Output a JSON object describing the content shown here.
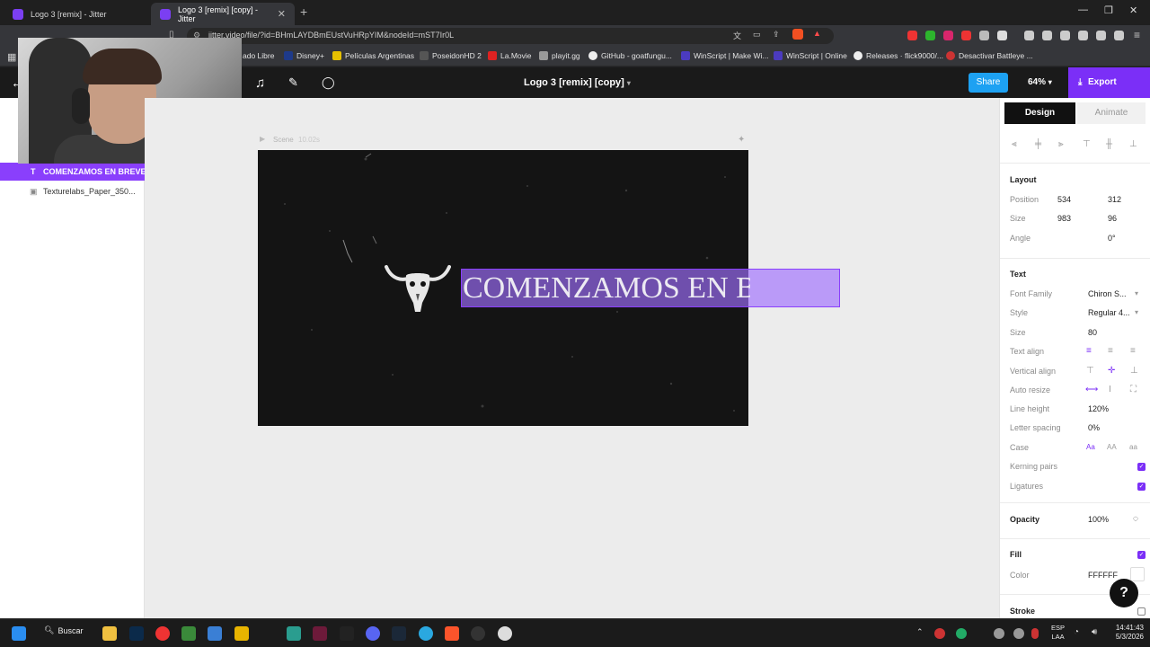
{
  "browser": {
    "tabs": [
      {
        "title": "Logo 3 [remix] - Jitter",
        "active": false
      },
      {
        "title": "Logo 3 [remix] [copy] - Jitter",
        "active": true
      }
    ],
    "url": "jitter.video/file/?id=BHmLAYDBmEUstVuHRpYIM&nodeId=mST7Ir0L",
    "bookmarks": [
      "ado Libre",
      "Disney+",
      "Películas Argentinas",
      "PoseidonHD 2",
      "La.Movie",
      "playit.gg",
      "GitHub - goatfungu...",
      "WinScript | Make Wi...",
      "WinScript | Online",
      "Releases · flick9000/...",
      "Desactivar Battleye ..."
    ]
  },
  "header": {
    "doc_title": "Logo 3 [remix] [copy]",
    "share_label": "Share",
    "zoom": "64%",
    "export_label": "Export"
  },
  "layers": [
    {
      "name": "COMENZAMOS EN BREVE",
      "type_icon": "T",
      "selected": true
    },
    {
      "name": "Texturelabs_Paper_350...",
      "type_icon": "▣",
      "selected": false
    }
  ],
  "canvas": {
    "scene_label": "Scene",
    "scene_duration": "10.02s",
    "text_layer": "COMENZAMOS EN B",
    "artboard_color": "#141414",
    "selection_color": "#8a3ffc"
  },
  "panel": {
    "tabs": {
      "design": "Design",
      "animate": "Animate"
    },
    "layout": {
      "title": "Layout",
      "position_label": "Position",
      "pos_x": "534",
      "pos_y": "312",
      "size_label": "Size",
      "w": "983",
      "h": "96",
      "angle_label": "Angle",
      "angle": "0°"
    },
    "text": {
      "title": "Text",
      "font_family_label": "Font Family",
      "font_family": "Chiron S...",
      "style_label": "Style",
      "style": "Regular 4...",
      "size_label": "Size",
      "size": "80",
      "text_align_label": "Text align",
      "vertical_align_label": "Vertical align",
      "auto_resize_label": "Auto resize",
      "line_height_label": "Line height",
      "line_height": "120%",
      "letter_spacing_label": "Letter spacing",
      "letter_spacing": "0%",
      "case_label": "Case",
      "case_options": [
        "Aa",
        "AA",
        "aa"
      ],
      "kerning_label": "Kerning pairs",
      "ligatures_label": "Ligatures"
    },
    "opacity": {
      "title": "Opacity",
      "value": "100%"
    },
    "fill": {
      "title": "Fill",
      "color_label": "Color",
      "color": "FFFFFF"
    },
    "stroke": {
      "title": "Stroke"
    }
  },
  "taskbar": {
    "search_label": "Buscar",
    "lang_top": "ESP",
    "lang_bottom": "LAA",
    "time": "14:41:43",
    "date": "5/3/2026"
  },
  "help_label": "?"
}
